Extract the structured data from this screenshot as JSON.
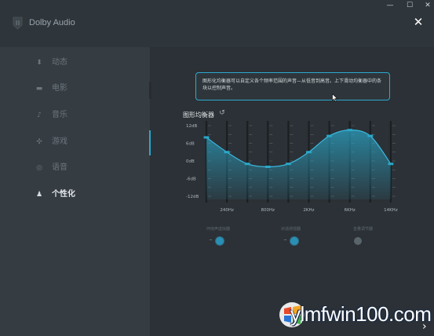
{
  "window": {
    "title": "Dolby Audio",
    "min_glyph": "—",
    "max_glyph": "☐",
    "close_glyph": "✕",
    "panel_close_glyph": "✕"
  },
  "sidebar": {
    "items": [
      {
        "label": "动态",
        "icon": "motion-icon",
        "glyph": "⬍"
      },
      {
        "label": "电影",
        "icon": "film-icon",
        "glyph": "▬"
      },
      {
        "label": "音乐",
        "icon": "music-note-icon",
        "glyph": "♪"
      },
      {
        "label": "游戏",
        "icon": "gamepad-icon",
        "glyph": "✣"
      },
      {
        "label": "语音",
        "icon": "voice-icon",
        "glyph": "◎"
      },
      {
        "label": "个性化",
        "icon": "person-icon",
        "glyph": "♟",
        "active": true
      }
    ]
  },
  "tooltip": {
    "text": "图形化均衡器可以自定义各个频率范围的声音—从低音到高音。上下滑动均衡器中的条块以控制声音。"
  },
  "equalizer": {
    "title": "图形均衡器",
    "reset_icon": "reset-icon",
    "reset_glyph": "↺",
    "y_labels": [
      "12dB",
      "6dB",
      "0dB",
      "-6dB",
      "-12dB"
    ],
    "freq_labels": [
      "240Hz",
      "800Hz",
      "2KHz",
      "6KHz",
      "14KHz"
    ],
    "band_gains_db": [
      8.0,
      3.0,
      -1.0,
      -2.0,
      -1.0,
      3.0,
      8.5,
      10.5,
      8.5,
      -1.0
    ],
    "y_range_db": [
      -12,
      12
    ],
    "accent_color": "#2aa7c9"
  },
  "toggles": [
    {
      "label": "环绕声虚拟器",
      "state": "on"
    },
    {
      "label": "对话增强器",
      "state": "on"
    },
    {
      "label": "音量调节器",
      "state": "off"
    }
  ],
  "watermark": {
    "text": "ylmfwin100.com"
  },
  "nav_next_glyph": "›"
}
